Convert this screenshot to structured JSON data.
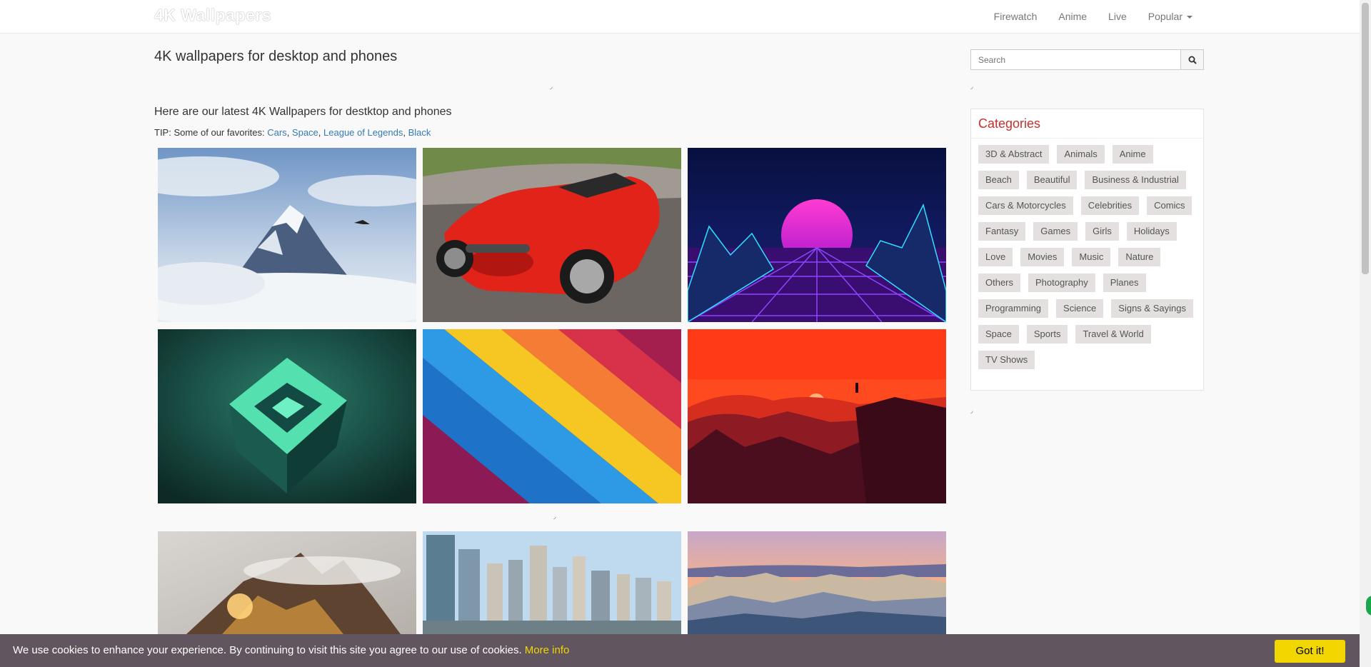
{
  "nav": {
    "brand": "4K Wallpapers",
    "links": [
      "Firewatch",
      "Anime",
      "Live",
      "Popular"
    ]
  },
  "main": {
    "heading": "4K wallpapers for desktop and phones",
    "subheading": "Here are our latest 4K Wallpapers for destktop and phones",
    "tip_prefix": "TIP: Some of our favorites: ",
    "favorites": [
      "Cars",
      "Space",
      "League of Legends",
      "Black"
    ],
    "ad_marker": "◞"
  },
  "search": {
    "placeholder": "Search"
  },
  "sidebar": {
    "categories_title": "Categories",
    "categories": [
      "3D & Abstract",
      "Animals",
      "Anime",
      "Beach",
      "Beautiful",
      "Business & Industrial",
      "Cars & Motorcycles",
      "Celebrities",
      "Comics",
      "Fantasy",
      "Games",
      "Girls",
      "Holidays",
      "Love",
      "Movies",
      "Music",
      "Nature",
      "Others",
      "Photography",
      "Planes",
      "Programming",
      "Science",
      "Signs & Sayings",
      "Space",
      "Sports",
      "Travel & World",
      "TV Shows"
    ]
  },
  "wallpapers": [
    "mountain-peak-clouds-eagle",
    "red-plymouth-prowler-car",
    "retro-synthwave-sun-grid",
    "green-abstract-3d-cube",
    "colorful-diagonal-stripes",
    "firewatch-sunset-landscape",
    "foggy-rocky-mountains-sunrise",
    "brisbane-city-skyline-river",
    "badlands-rock-formations-sunset"
  ],
  "cookie": {
    "text": "We use cookies to enhance your experience. By continuing to visit this site you agree to our use of cookies.",
    "more_info": "More info",
    "accept": "Got it!"
  },
  "colors": {
    "link": "#337ab7",
    "category_title": "#c9302c",
    "cookie_bg": "#61565f",
    "cookie_accent": "#f1d600"
  }
}
